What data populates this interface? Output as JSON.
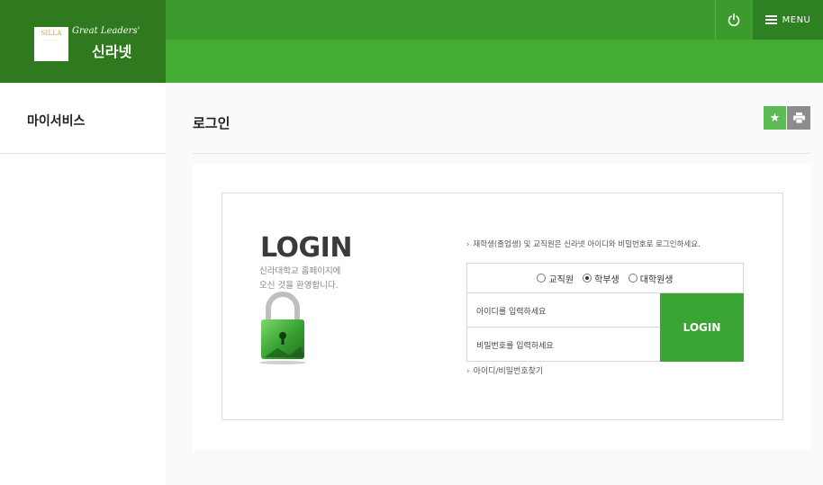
{
  "logo": {
    "badge_text": "SILLA",
    "tagline": "Great Leaders'",
    "name": "신라넷"
  },
  "header": {
    "menu_label": "MENU",
    "power_icon": "power-icon",
    "menu_icon": "hamburger-icon"
  },
  "sidebar": {
    "title": "마이서비스"
  },
  "page": {
    "title": "로그인",
    "actions": [
      {
        "icon": "star-icon"
      },
      {
        "icon": "print-icon"
      }
    ]
  },
  "login": {
    "heading": "LOGIN",
    "welcome_line1": "신라대학교 홈페이지에",
    "welcome_line2": "오신 것을 환영합니다.",
    "notice": "재학생(졸업생) 및 교직원은 신라넷 아이디와 비밀번호로 로그인하세요.",
    "radio_options": [
      {
        "label": "교직원",
        "selected": false
      },
      {
        "label": "학부생",
        "selected": true
      },
      {
        "label": "대학원생",
        "selected": false
      }
    ],
    "id_placeholder": "아이디를 입력하세요",
    "pw_placeholder": "비밀번호를 입력하세요",
    "button_label": "LOGIN",
    "find_link": "아이디/비밀번호찾기"
  },
  "colors": {
    "brand_dark": "#2f7a1f",
    "brand": "#3b9c2d",
    "brand_light": "#44ab33",
    "button": "#3aa535"
  }
}
